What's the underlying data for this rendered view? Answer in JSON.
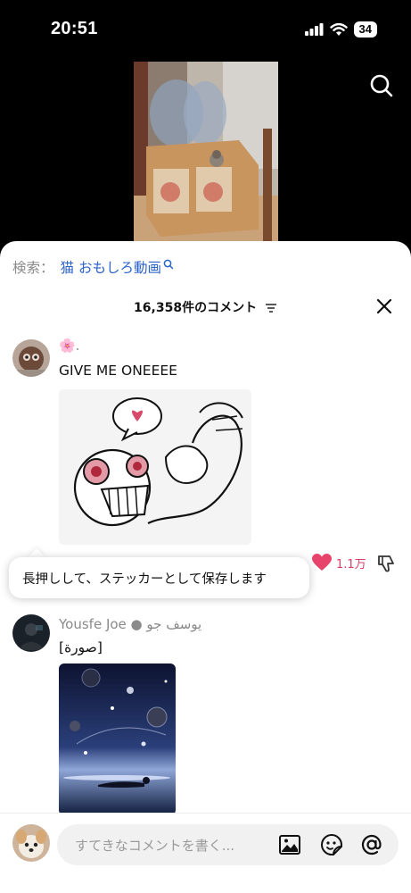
{
  "status_bar": {
    "time": "20:51",
    "battery": "34"
  },
  "search_suggestion": {
    "label": "検索：",
    "term": "猫 おもしろ動画"
  },
  "comments_header": {
    "count": "16,358件のコメント"
  },
  "comments": [
    {
      "name": "🌸.",
      "text": "GIVE ME ONEEEE",
      "likes": "1.1万"
    },
    {
      "name": "Yousfe Joe ● يوسف جو",
      "text": "[صورة]"
    }
  ],
  "tooltip": {
    "text": "長押しして、ステッカーとして保存します"
  },
  "input": {
    "placeholder": "すてきなコメントを書く..."
  },
  "colors": {
    "accent": "#2c63c8",
    "like": "#d64068"
  }
}
